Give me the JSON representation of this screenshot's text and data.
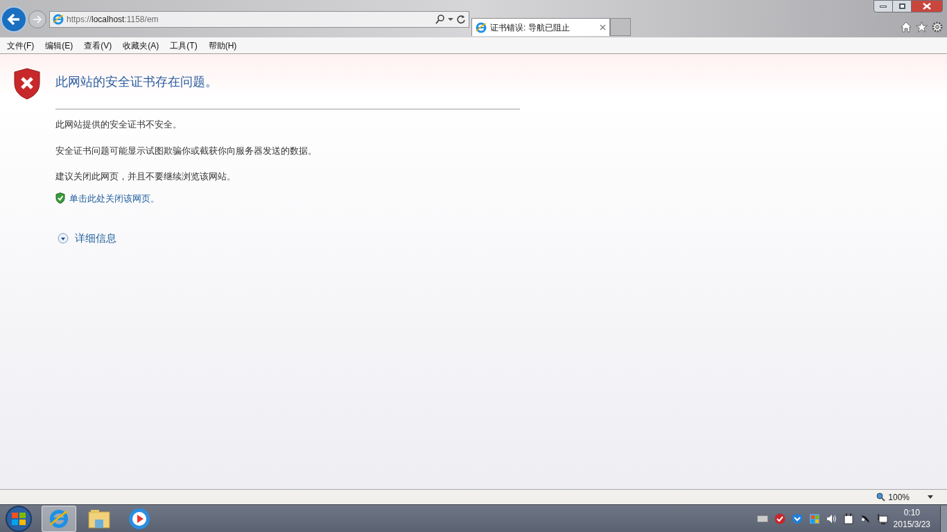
{
  "address_bar": {
    "scheme": "https://",
    "host": "localhost",
    "rest": ":1158/em"
  },
  "tabs": [
    {
      "label": "证书错误: 导航已阻止",
      "selected": true
    }
  ],
  "menu": [
    "文件(F)",
    "编辑(E)",
    "查看(V)",
    "收藏夹(A)",
    "工具(T)",
    "帮助(H)"
  ],
  "page": {
    "heading": "此网站的安全证书存在问题。",
    "paragraphs": [
      "此网站提供的安全证书不安全。",
      "安全证书问题可能显示试图欺骗你或截获你向服务器发送的数据。",
      "建议关闭此网页，并且不要继续浏览该网站。"
    ],
    "close_link": "单击此处关闭该网页。",
    "details": {
      "label": "详细信息",
      "expanded": false
    }
  },
  "status_bar": {
    "zoom": "100%"
  },
  "taskbar": {
    "apps": [
      {
        "kind": "ie",
        "selected": true
      },
      {
        "kind": "folder",
        "selected": false
      },
      {
        "kind": "player",
        "selected": false
      }
    ],
    "clock": {
      "time": "0:10",
      "date": "2015/3/23"
    }
  }
}
